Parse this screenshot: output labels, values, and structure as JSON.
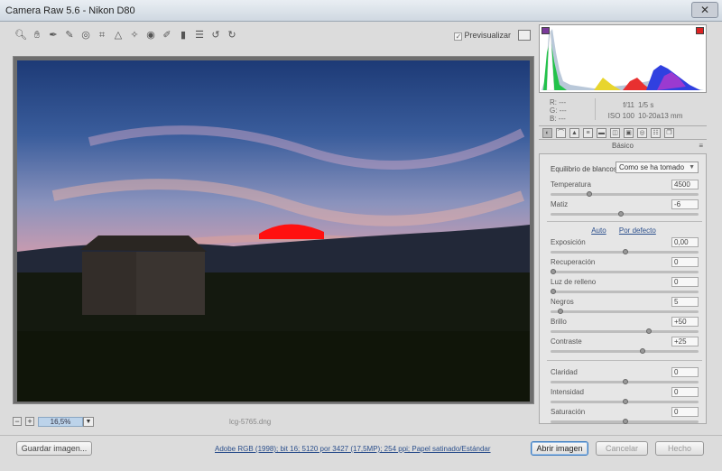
{
  "window": {
    "title": "Camera Raw 5.6 -  Nikon D80",
    "close_icon": "close-icon"
  },
  "toolbar": {
    "tools": [
      "zoom-icon",
      "hand-icon",
      "white-balance-icon",
      "color-sampler-icon",
      "target-adjust-icon",
      "crop-icon",
      "straighten-icon",
      "spot-removal-icon",
      "red-eye-icon",
      "adjustment-brush-icon",
      "graduated-filter-icon",
      "preferences-icon",
      "rotate-left-icon",
      "rotate-right-icon"
    ],
    "preview_label": "Previsualizar"
  },
  "zoom": {
    "value": "16,5%",
    "filename": "lcg-5765.dng"
  },
  "histogram": {
    "readout": {
      "r": "R:   ---",
      "g": "G:   ---",
      "b": "B:   ---"
    },
    "aperture": "f/11",
    "shutter": "1/5 s",
    "iso": "ISO 100",
    "lens": "10-20a13 mm"
  },
  "panel": {
    "title": "Básico",
    "tabs": [
      "basic-tab-icon",
      "tone-curve-tab-icon",
      "detail-tab-icon",
      "hsl-tab-icon",
      "split-toning-tab-icon",
      "lens-corrections-tab-icon",
      "effects-tab-icon",
      "camera-calibration-tab-icon",
      "presets-tab-icon",
      "snapshots-tab-icon"
    ],
    "wb_label": "Equilibrio de blancos:",
    "wb_value": "Como se ha tomado",
    "auto_label": "Auto",
    "default_label": "Por defecto",
    "sliders": [
      {
        "label": "Temperatura",
        "value": "4500",
        "level": 0.25
      },
      {
        "label": "Matiz",
        "value": "-6",
        "level": 0.47
      },
      {
        "label": "Exposición",
        "value": "0,00",
        "level": 0.5
      },
      {
        "label": "Recuperación",
        "value": "0",
        "level": 0.0
      },
      {
        "label": "Luz de relleno",
        "value": "0",
        "level": 0.0
      },
      {
        "label": "Negros",
        "value": "5",
        "level": 0.05
      },
      {
        "label": "Brillo",
        "value": "+50",
        "level": 0.66
      },
      {
        "label": "Contraste",
        "value": "+25",
        "level": 0.62
      },
      {
        "label": "Claridad",
        "value": "0",
        "level": 0.5
      },
      {
        "label": "Intensidad",
        "value": "0",
        "level": 0.5
      },
      {
        "label": "Saturación",
        "value": "0",
        "level": 0.5
      }
    ]
  },
  "bottom": {
    "save_label": "Guardar imagen...",
    "info": "Adobe RGB (1998); bit 16; 5120 por 3427 (17,5MP); 254 ppi; Papel satinado/Estándar",
    "open_label": "Abrir imagen",
    "cancel_label": "Cancelar",
    "done_label": "Hecho"
  }
}
